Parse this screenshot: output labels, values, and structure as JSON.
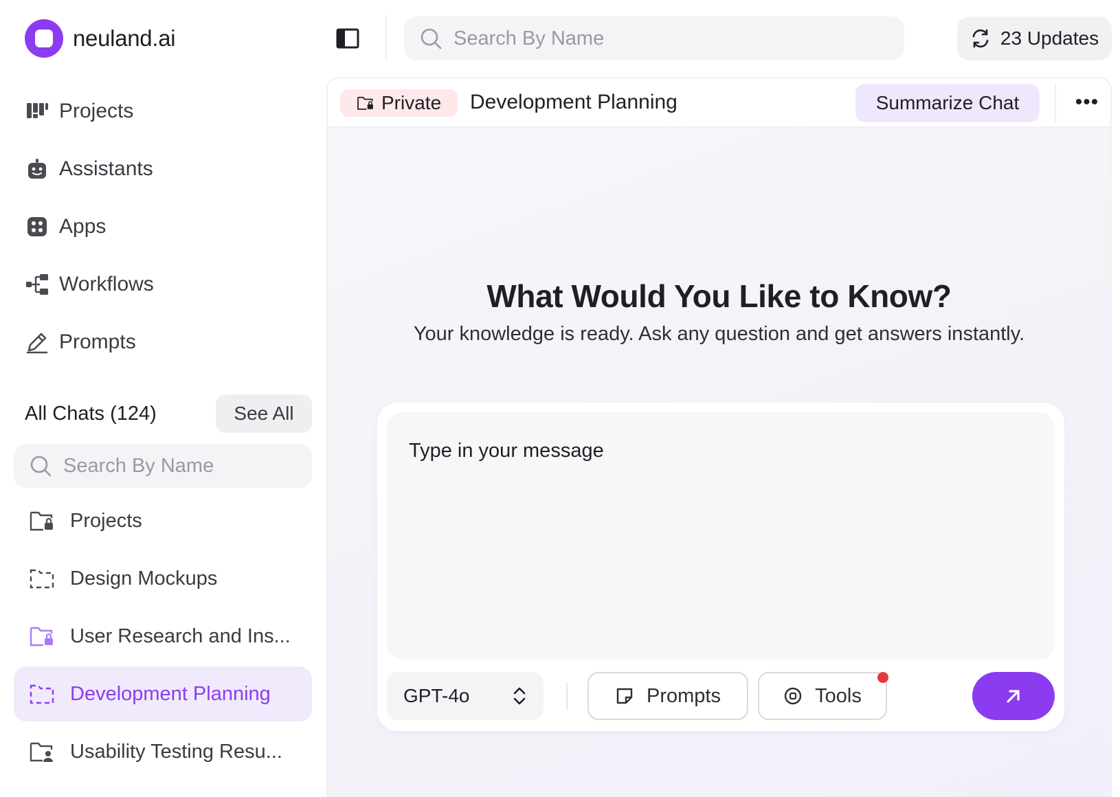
{
  "brand": {
    "name": "neuland.ai",
    "accent": "#8b3cf0"
  },
  "nav": [
    {
      "label": "Projects",
      "icon": "projects-grid-icon"
    },
    {
      "label": "Assistants",
      "icon": "robot-icon"
    },
    {
      "label": "Apps",
      "icon": "apps-icon"
    },
    {
      "label": "Workflows",
      "icon": "workflow-icon"
    },
    {
      "label": "Prompts",
      "icon": "pencil-icon"
    }
  ],
  "chats": {
    "title": "All Chats (124)",
    "see_all": "See All",
    "search_placeholder": "Search By Name",
    "items": [
      {
        "label": "Projects",
        "icon": "locked-folder-icon",
        "active": false
      },
      {
        "label": "Design Mockups",
        "icon": "dashed-folder-icon",
        "active": false
      },
      {
        "label": "User Research and Ins...",
        "icon": "locked-folder-icon",
        "active": false
      },
      {
        "label": "Development Planning",
        "icon": "dashed-folder-icon",
        "active": true
      },
      {
        "label": "Usability Testing Resu...",
        "icon": "shared-folder-icon",
        "active": false
      }
    ]
  },
  "topbar": {
    "search_placeholder": "Search By Name",
    "updates_label": "23 Updates"
  },
  "chat": {
    "badge": "Private",
    "title": "Development Planning",
    "summarize_label": "Summarize Chat",
    "more_label": "•••",
    "hero_title": "What Would You Like to Know?",
    "hero_subtitle": "Your knowledge is ready. Ask any question and get answers instantly.",
    "composer": {
      "placeholder": "Type in your message",
      "model": "GPT-4o",
      "prompts_label": "Prompts",
      "tools_label": "Tools",
      "tools_has_notification": true
    }
  },
  "colors": {
    "accent": "#8b3cf0",
    "active_bg": "#f1eafd",
    "private_badge_bg": "#fde8ea",
    "summarize_bg": "#efe8fc",
    "notification": "#e8383d"
  }
}
